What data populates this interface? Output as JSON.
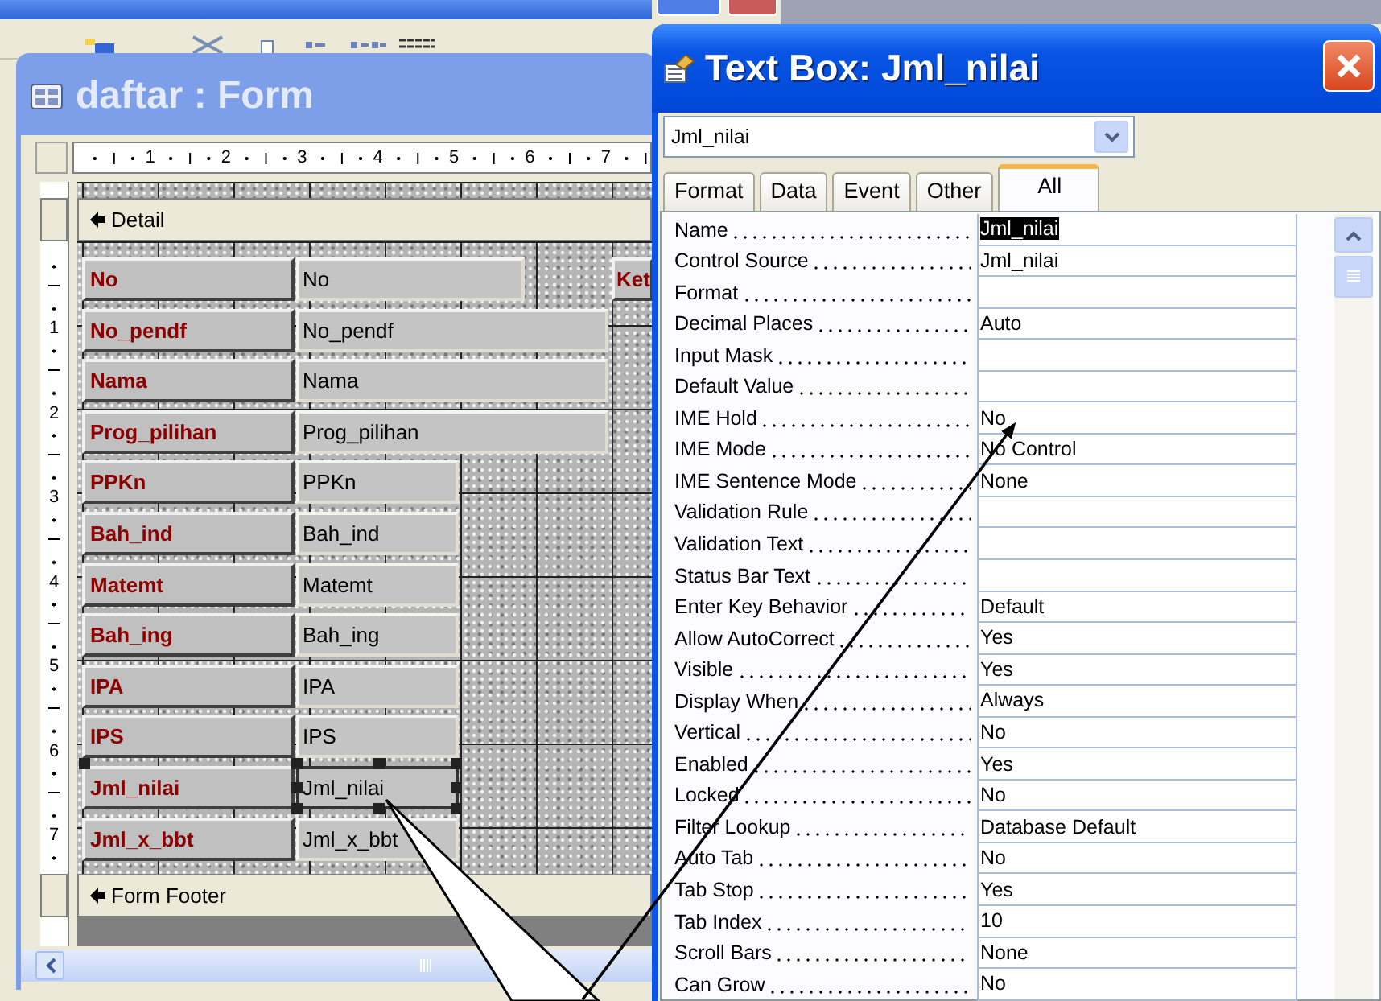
{
  "form_window": {
    "title": "daftar : Form",
    "horizontal_ruler": [
      "1",
      "2",
      "3",
      "4",
      "5",
      "6",
      "7"
    ],
    "vertical_ruler": [
      "1",
      "2",
      "3",
      "4",
      "5",
      "6",
      "7"
    ],
    "detail_section": "Detail",
    "side_label": "Ket",
    "footer_section": "Form Footer",
    "fields": [
      {
        "label": "No",
        "control": "No",
        "selected": false
      },
      {
        "label": "No_pendf",
        "control": "No_pendf",
        "selected": false
      },
      {
        "label": "Nama",
        "control": "Nama",
        "selected": false
      },
      {
        "label": "Prog_pilihan",
        "control": "Prog_pilihan",
        "selected": false
      },
      {
        "label": "PPKn",
        "control": "PPKn",
        "selected": false
      },
      {
        "label": "Bah_ind",
        "control": "Bah_ind",
        "selected": false
      },
      {
        "label": "Matemt",
        "control": "Matemt",
        "selected": false
      },
      {
        "label": "Bah_ing",
        "control": "Bah_ing",
        "selected": false
      },
      {
        "label": "IPA",
        "control": "IPA",
        "selected": false
      },
      {
        "label": "IPS",
        "control": "IPS",
        "selected": false
      },
      {
        "label": "Jml_nilai",
        "control": "Jml_nilai",
        "selected": true
      },
      {
        "label": "Jml_x_bbt",
        "control": "Jml_x_bbt",
        "selected": false
      }
    ]
  },
  "property_sheet": {
    "title": "Text Box: Jml_nilai",
    "object_selector": "Jml_nilai",
    "tabs": [
      {
        "label": "Format",
        "selected": false
      },
      {
        "label": "Data",
        "selected": false
      },
      {
        "label": "Event",
        "selected": false
      },
      {
        "label": "Other",
        "selected": false
      },
      {
        "label": "All",
        "selected": true
      }
    ],
    "properties": [
      {
        "name": "Name",
        "value": "Jml_nilai",
        "selected": true
      },
      {
        "name": "Control Source",
        "value": "Jml_nilai",
        "selected": false
      },
      {
        "name": "Format",
        "selected": false
      },
      {
        "name": "Decimal Places",
        "value": "Auto",
        "selected": false
      },
      {
        "name": "Input Mask",
        "selected": false
      },
      {
        "name": "Default Value",
        "selected": false
      },
      {
        "name": "IME Hold",
        "value": "No",
        "selected": false
      },
      {
        "name": "IME Mode",
        "value": "No Control",
        "selected": false
      },
      {
        "name": "IME Sentence Mode",
        "value": "None",
        "selected": false
      },
      {
        "name": "Validation Rule",
        "selected": false
      },
      {
        "name": "Validation Text",
        "selected": false
      },
      {
        "name": "Status Bar Text",
        "selected": false
      },
      {
        "name": "Enter Key Behavior",
        "value": "Default",
        "selected": false
      },
      {
        "name": "Allow AutoCorrect",
        "value": "Yes",
        "selected": false
      },
      {
        "name": "Visible",
        "value": "Yes",
        "selected": false
      },
      {
        "name": "Display When",
        "value": "Always",
        "selected": false
      },
      {
        "name": "Vertical",
        "value": "No",
        "selected": false
      },
      {
        "name": "Enabled",
        "value": "Yes",
        "selected": false
      },
      {
        "name": "Locked",
        "value": "No",
        "selected": false
      },
      {
        "name": "Filter Lookup",
        "value": "Database Default",
        "selected": false
      },
      {
        "name": "Auto Tab",
        "value": "No",
        "selected": false
      },
      {
        "name": "Tab Stop",
        "value": "Yes",
        "selected": false
      },
      {
        "name": "Tab Index",
        "value": "10",
        "selected": false
      },
      {
        "name": "Scroll Bars",
        "value": "None",
        "selected": false
      },
      {
        "name": "Can Grow",
        "value": "No",
        "selected": false
      }
    ]
  }
}
